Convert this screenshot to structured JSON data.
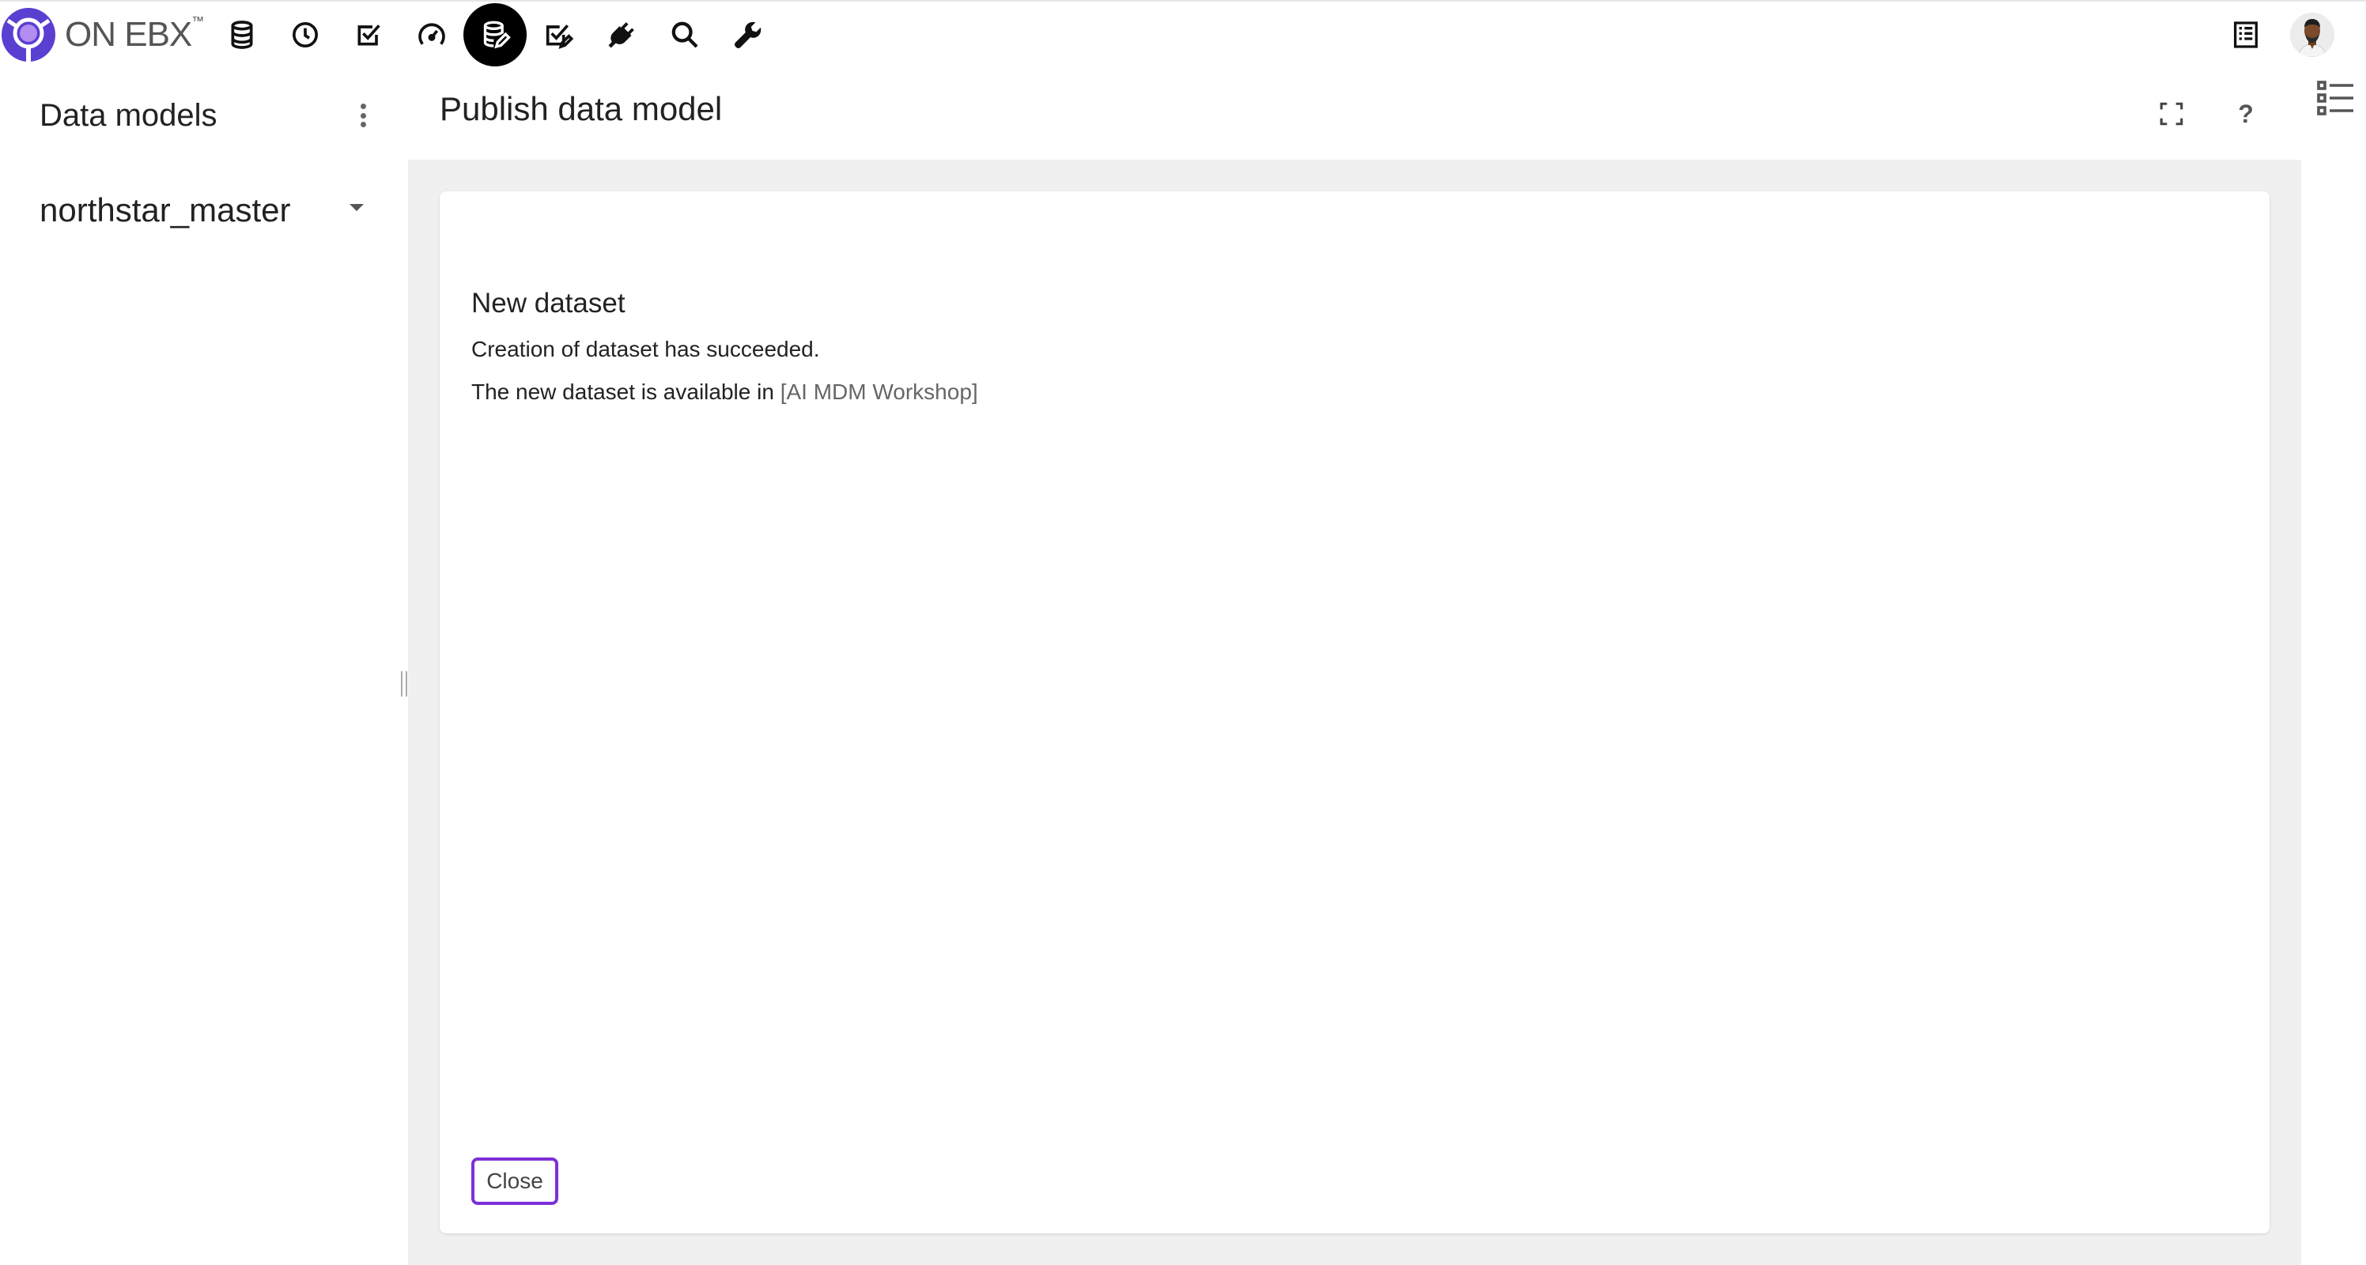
{
  "brand": {
    "name": "ON EBX",
    "trademark": "™"
  },
  "nav": {
    "icons": [
      {
        "name": "database-icon"
      },
      {
        "name": "clock-icon"
      },
      {
        "name": "checkbox-icon"
      },
      {
        "name": "gauge-icon"
      },
      {
        "name": "data-model-icon",
        "active": true
      },
      {
        "name": "task-check-icon"
      },
      {
        "name": "plug-icon"
      },
      {
        "name": "search-icon"
      },
      {
        "name": "wrench-icon"
      }
    ]
  },
  "sidebar": {
    "title": "Data models",
    "selected_model": "northstar_master"
  },
  "main": {
    "title": "Publish data model",
    "card": {
      "heading": "New dataset",
      "message": "Creation of dataset has succeeded.",
      "availability_prefix": "The new dataset is available in",
      "dataspace_link": "[AI MDM Workshop]",
      "close_label": "Close"
    }
  },
  "colors": {
    "accent": "#7c2fd6",
    "logo": "#5b3fd1",
    "panel_bg": "#f0f0f0"
  }
}
